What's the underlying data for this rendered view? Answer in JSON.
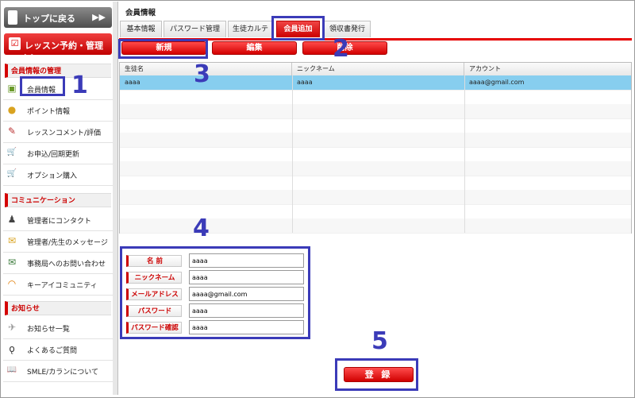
{
  "sidebar": {
    "top_button": {
      "label": "トップに戻る",
      "arrow": "▶▶"
    },
    "lesson_button": {
      "label": "レッスン予約・管理",
      "arrow": "▶▶",
      "icon_glyph": "☑"
    },
    "sections": [
      {
        "title": "会員情報の管理"
      },
      {
        "title": "コミュニケーション"
      },
      {
        "title": "お知らせ"
      }
    ],
    "items": [
      {
        "label": "会員情報",
        "icon": "member-card-icon",
        "glyph": "▣"
      },
      {
        "label": "ポイント情報",
        "icon": "coins-icon",
        "glyph": "●"
      },
      {
        "label": "レッスンコメント/評価",
        "icon": "note-pencil-icon",
        "glyph": "✎"
      },
      {
        "label": "お申込/回期更新",
        "icon": "cart-icon",
        "glyph": "🛒"
      },
      {
        "label": "オプション購入",
        "icon": "cart-icon",
        "glyph": "🛒"
      },
      {
        "label": "管理者にコンタクト",
        "icon": "person-icon",
        "glyph": "♟"
      },
      {
        "label": "管理者/先生のメッセージ",
        "icon": "envelope-icon",
        "glyph": "✉"
      },
      {
        "label": "事務局へのお問い合わせ",
        "icon": "mail-icon",
        "glyph": "✉"
      },
      {
        "label": "キーアイコミュニティ",
        "icon": "rainbow-icon",
        "glyph": "◠"
      },
      {
        "label": "お知らせ一覧",
        "icon": "paper-plane-icon",
        "glyph": "✈"
      },
      {
        "label": "よくあるご質問",
        "icon": "microphone-icon",
        "glyph": "ǫ"
      },
      {
        "label": "SMLE/カランについて",
        "icon": "book-icon",
        "glyph": "📖"
      }
    ]
  },
  "main": {
    "title": "会員情報",
    "tabs": [
      {
        "label": "基本情報"
      },
      {
        "label": "パスワード管理"
      },
      {
        "label": "生徒カルテ"
      },
      {
        "label": "会員追加"
      },
      {
        "label": "領収書発行"
      }
    ],
    "actions": {
      "new": "新規",
      "edit": "編集",
      "delete": "削除"
    },
    "table": {
      "columns": [
        "生徒名",
        "ニックネーム",
        "アカウント"
      ],
      "rows": [
        {
          "name": "aaaa",
          "nickname": "aaaa",
          "account": "aaaa@gmail.com"
        }
      ]
    },
    "form": {
      "fields": [
        {
          "label": "名 前",
          "value": "aaaa"
        },
        {
          "label": "ニックネーム",
          "value": "aaaa"
        },
        {
          "label": "メールアドレス",
          "value": "aaaa@gmail.com"
        },
        {
          "label": "パスワード",
          "value": "aaaa"
        },
        {
          "label": "パスワード確認",
          "value": "aaaa"
        }
      ],
      "submit": "登 録"
    }
  },
  "annotations": [
    "1",
    "2",
    "3",
    "4",
    "5"
  ],
  "colors": {
    "accent_red": "#d40000",
    "annotation_blue": "#3b3bb8",
    "selected_row": "#87ceef"
  }
}
